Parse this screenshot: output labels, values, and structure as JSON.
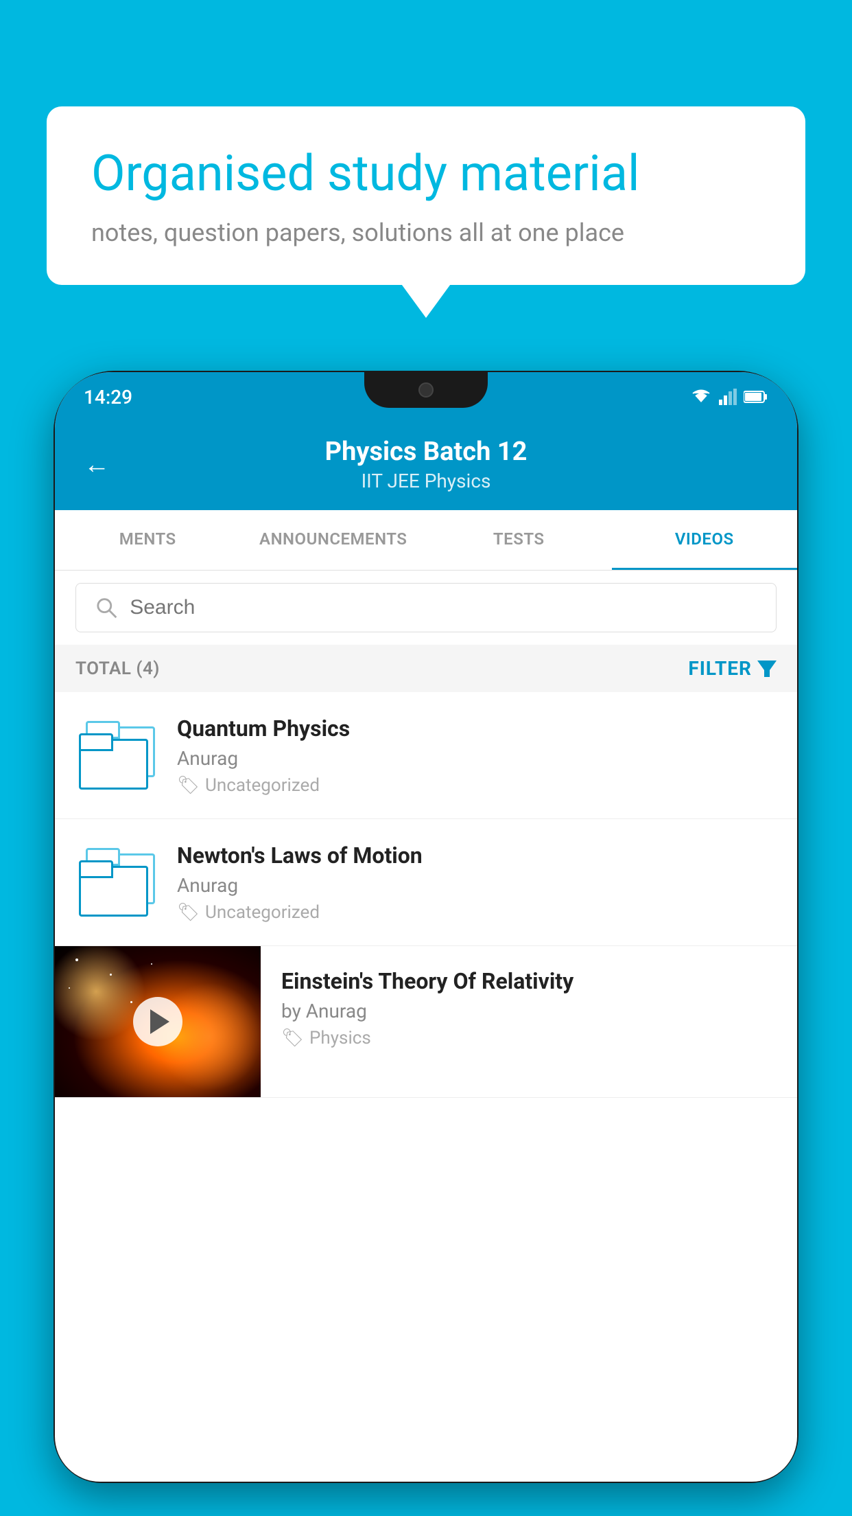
{
  "background": {
    "color": "#00B8E0"
  },
  "speech_bubble": {
    "title": "Organised study material",
    "subtitle": "notes, question papers, solutions all at one place"
  },
  "status_bar": {
    "time": "14:29"
  },
  "app_header": {
    "title": "Physics Batch 12",
    "subtitle": "IIT JEE   Physics",
    "back_label": "←"
  },
  "tabs": [
    {
      "label": "MENTS",
      "active": false
    },
    {
      "label": "ANNOUNCEMENTS",
      "active": false
    },
    {
      "label": "TESTS",
      "active": false
    },
    {
      "label": "VIDEOS",
      "active": true
    }
  ],
  "search": {
    "placeholder": "Search"
  },
  "filter_bar": {
    "total_label": "TOTAL (4)",
    "filter_label": "FILTER"
  },
  "videos": [
    {
      "title": "Quantum Physics",
      "author": "Anurag",
      "tag": "Uncategorized",
      "has_thumbnail": false
    },
    {
      "title": "Newton's Laws of Motion",
      "author": "Anurag",
      "tag": "Uncategorized",
      "has_thumbnail": false
    },
    {
      "title": "Einstein's Theory Of Relativity",
      "author": "by Anurag",
      "tag": "Physics",
      "has_thumbnail": true
    }
  ]
}
